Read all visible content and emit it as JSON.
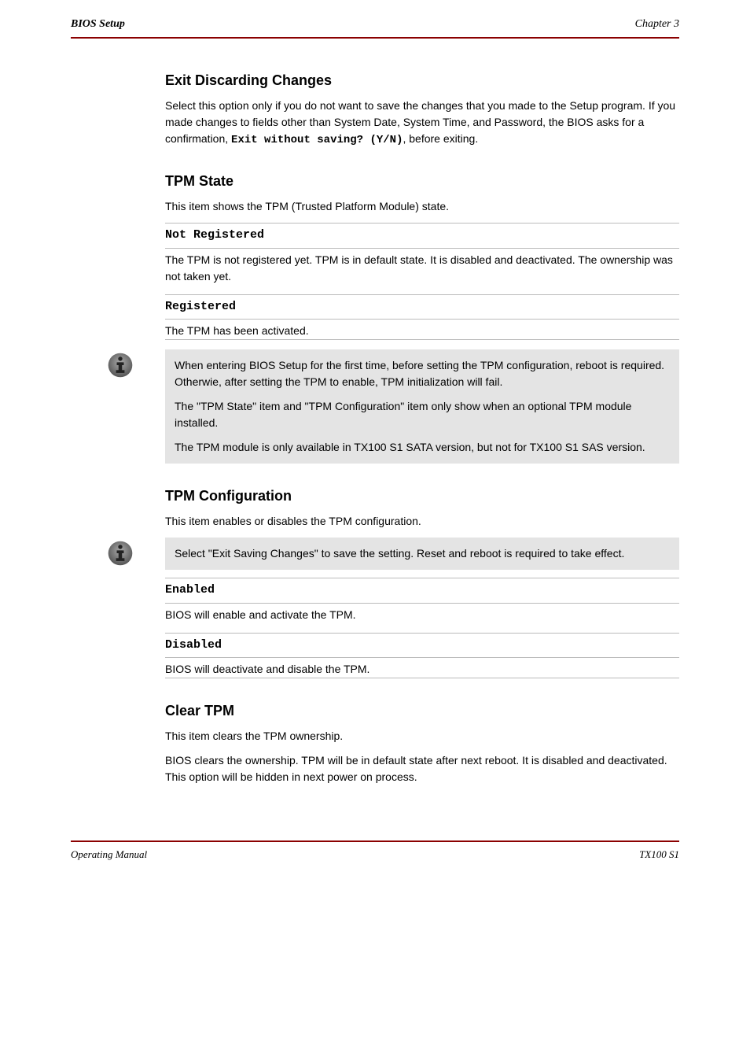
{
  "header": {
    "title": "BIOS Setup",
    "chapter": "Chapter 3"
  },
  "exitDiscard": {
    "heading": "Exit Discarding Changes",
    "p1_pre": "Select this option only if you do not want to save the changes that you made to the Setup program. If you made changes to fields other than System Date, System Time, and Password, the BIOS asks for a confirmation, ",
    "p1_mono": "Exit without saving? (Y/N)",
    "p1_post": ", before exiting."
  },
  "tpm": {
    "heading": "TPM State",
    "intro": "This item shows the TPM (Trusted Platform Module) state.",
    "defs": [
      {
        "term": "Not Registered",
        "desc": "The TPM is not registered yet. TPM is in default state. It is disabled and deactivated. The ownership was not taken yet."
      },
      {
        "term": "Registered",
        "desc": "The TPM has been activated."
      }
    ],
    "note": [
      "When entering BIOS Setup for the first time, before setting the TPM configuration, reboot is required. Otherwie, after setting the TPM to enable, TPM initialization will fail.",
      "The \"TPM State\" item and \"TPM Configuration\" item only show when an optional TPM module installed.",
      "The TPM module is only available in TX100 S1 SATA version, but not for TX100 S1 SAS version."
    ]
  },
  "tpmConfig": {
    "heading": "TPM Configuration",
    "intro": "This item enables or disables the TPM configuration.",
    "note": "Select \"Exit Saving Changes\" to save the setting. Reset and reboot is required to take effect.",
    "defs": [
      {
        "term": "Enabled",
        "desc": "BIOS will enable and activate the TPM."
      },
      {
        "term": "Disabled",
        "desc": "BIOS will deactivate and disable the TPM."
      }
    ]
  },
  "clearTpm": {
    "heading": "Clear TPM",
    "p1": "This item clears the TPM ownership.",
    "p2": "BIOS clears the ownership. TPM will be in default state after next reboot. It is disabled and deactivated. This option will be hidden in next power on process."
  },
  "footer": {
    "left": "Operating Manual",
    "right": "TX100 S1"
  },
  "icons": {
    "info": "info-icon"
  }
}
